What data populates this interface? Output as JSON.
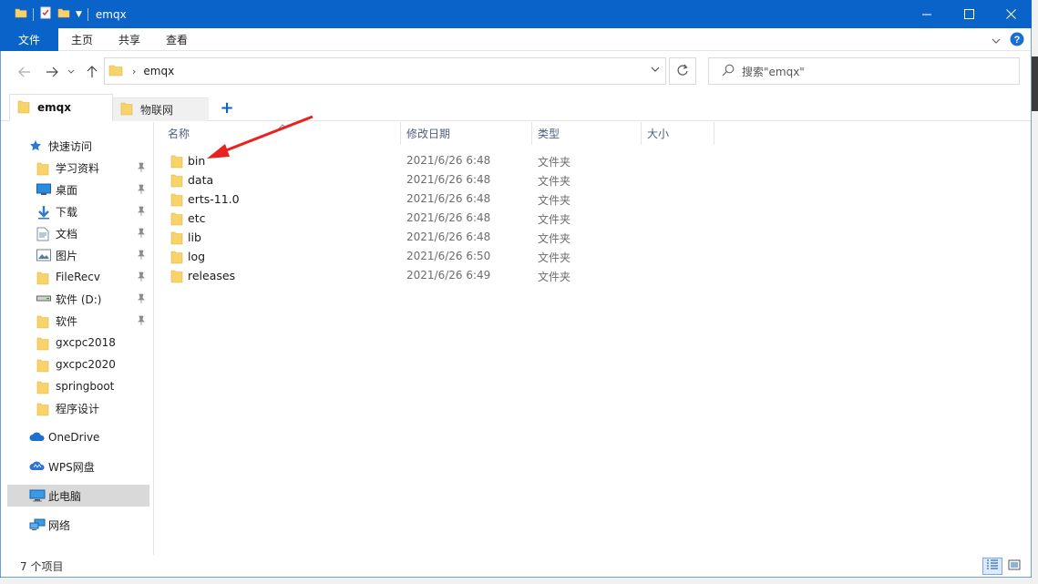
{
  "window": {
    "title": "emqx",
    "accent": "#0a63c9"
  },
  "ribbon": {
    "tabs": [
      "文件",
      "主页",
      "共享",
      "查看"
    ]
  },
  "address": {
    "path": "emqx",
    "search_placeholder": "搜索\"emqx\""
  },
  "folder_tabs": {
    "tabs": [
      {
        "label": "emqx",
        "active": true
      },
      {
        "label": "物联网",
        "active": false
      }
    ],
    "add_label": "+"
  },
  "sidebar": {
    "quick_access": "快速访问",
    "pinned": [
      {
        "label": "学习资料",
        "icon": "folder-icon"
      },
      {
        "label": "桌面",
        "icon": "desktop-icon"
      },
      {
        "label": "下载",
        "icon": "download-icon"
      },
      {
        "label": "文档",
        "icon": "document-icon"
      },
      {
        "label": "图片",
        "icon": "picture-icon"
      },
      {
        "label": "FileRecv",
        "icon": "folder-icon"
      },
      {
        "label": "软件 (D:)",
        "icon": "drive-icon"
      },
      {
        "label": "软件",
        "icon": "folder-icon"
      }
    ],
    "unpinned": [
      {
        "label": "gxcpc2018"
      },
      {
        "label": "gxcpc2020"
      },
      {
        "label": "springboot"
      },
      {
        "label": "程序设计"
      }
    ],
    "locations": [
      {
        "label": "OneDrive",
        "icon": "onedrive-icon"
      },
      {
        "label": "WPS网盘",
        "icon": "wps-cloud-icon"
      },
      {
        "label": "此电脑",
        "icon": "computer-icon",
        "selected": true
      },
      {
        "label": "网络",
        "icon": "network-icon"
      }
    ]
  },
  "columns": {
    "name": "名称",
    "modified": "修改日期",
    "type": "类型",
    "size": "大小"
  },
  "files": [
    {
      "name": "bin",
      "modified": "2021/6/26 6:48",
      "type": "文件夹"
    },
    {
      "name": "data",
      "modified": "2021/6/26 6:48",
      "type": "文件夹"
    },
    {
      "name": "erts-11.0",
      "modified": "2021/6/26 6:48",
      "type": "文件夹"
    },
    {
      "name": "etc",
      "modified": "2021/6/26 6:48",
      "type": "文件夹"
    },
    {
      "name": "lib",
      "modified": "2021/6/26 6:48",
      "type": "文件夹"
    },
    {
      "name": "log",
      "modified": "2021/6/26 6:50",
      "type": "文件夹"
    },
    {
      "name": "releases",
      "modified": "2021/6/26 6:49",
      "type": "文件夹"
    }
  ],
  "status": {
    "item_count": "7 个项目"
  }
}
